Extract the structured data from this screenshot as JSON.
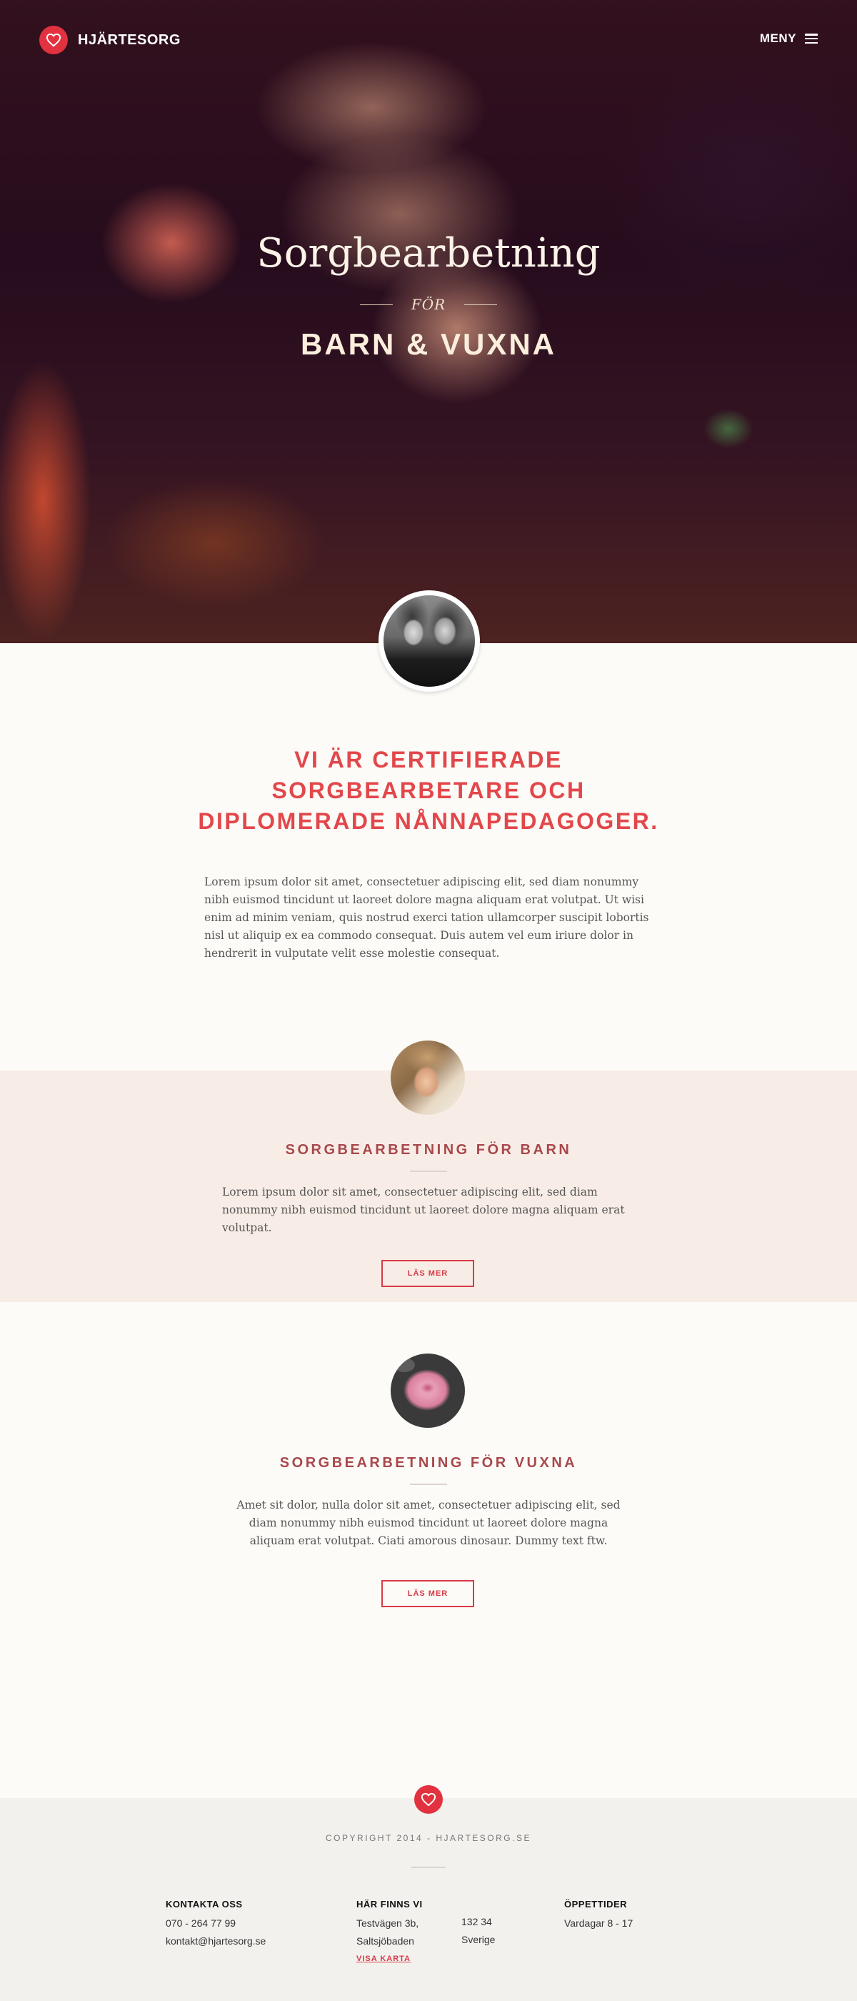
{
  "brand": {
    "name": "HJÄRTESORG",
    "logo_icon": "heart-icon",
    "accent": "#e2323f"
  },
  "nav": {
    "menu_label": "MENY",
    "menu_icon": "hamburger-icon"
  },
  "hero": {
    "title": "Sorgbearbetning",
    "for_word": "FÖR",
    "subtitle": "BARN & VUXNA"
  },
  "intro": {
    "heading": "VI ÄR CERTIFIERADE SORGBEARBETARE OCH DIPLOMERADE NÅNNAPEDAGOGER.",
    "text": "Lorem ipsum dolor sit amet, consectetuer adipiscing elit, sed diam nonummy nibh euismod tincidunt ut laoreet dolore magna aliquam erat volutpat. Ut wisi enim ad minim veniam, quis nostrud exerci tation ullamcorper suscipit lobortis nisl ut aliquip ex ea commodo consequat. Duis autem vel eum iriure dolor in hendrerit in vulputate velit esse molestie consequat."
  },
  "sections": [
    {
      "title": "SORGBEARBETNING FÖR BARN",
      "text": "Lorem ipsum dolor sit amet, consectetuer adipiscing elit, sed diam nonummy nibh euismod tincidunt ut laoreet dolore magna aliquam erat volutpat.",
      "button": "LÄS MER"
    },
    {
      "title": "SORGBEARBETNING FÖR VUXNA",
      "text": "Amet sit dolor, nulla dolor sit amet, consectetuer adipiscing elit, sed diam nonummy nibh euismod tincidunt ut laoreet dolore magna aliquam erat volutpat. Ciati amorous dinosaur. Dummy text ftw.",
      "button": "LÄS MER"
    }
  ],
  "footer": {
    "copyright": "COPYRIGHT 2014 - HJARTESORG.SE",
    "contact": {
      "heading": "KONTAKTA OSS",
      "phone": "070 - 264 77 99",
      "email": "kontakt@hjartesorg.se"
    },
    "location": {
      "heading": "HÄR FINNS VI",
      "street": "Testvägen 3b,",
      "city": "Saltsjöbaden",
      "zip": "132 34",
      "country": "Sverige",
      "map_link": "VISA KARTA"
    },
    "hours": {
      "heading": "ÖPPETTIDER",
      "text": "Vardagar 8 - 17"
    }
  }
}
